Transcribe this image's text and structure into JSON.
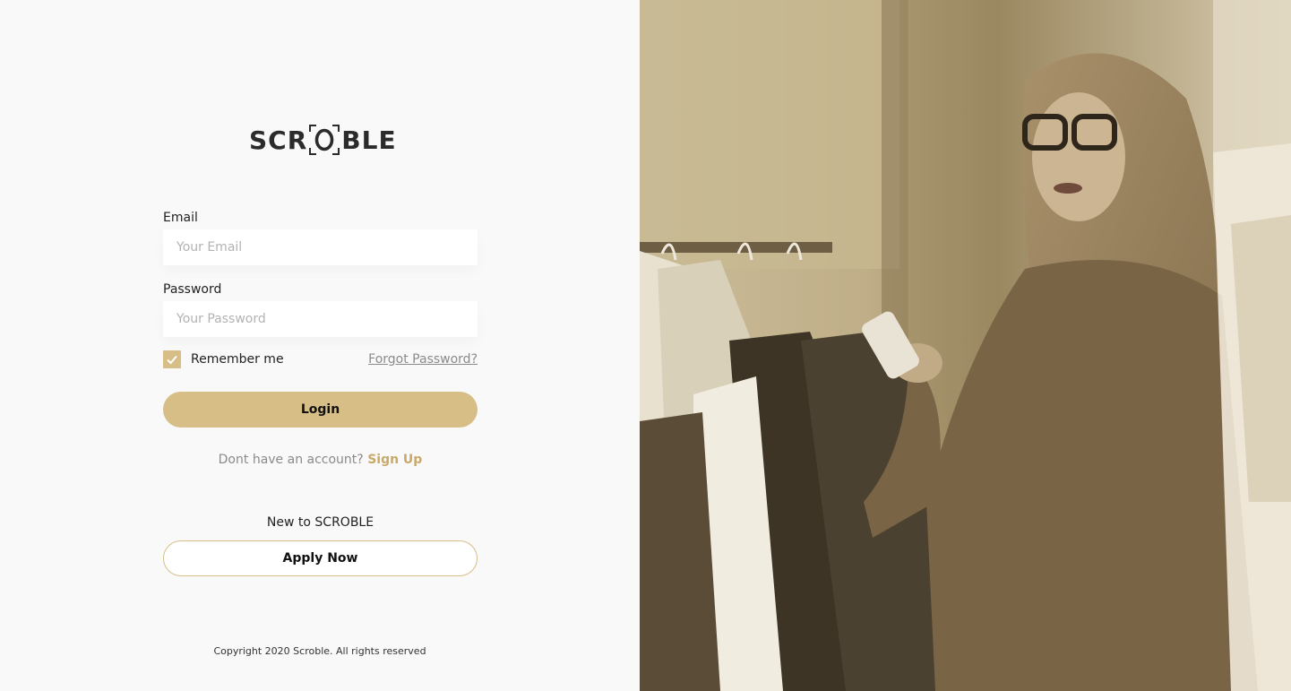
{
  "brand": {
    "logo_text_left": "SCR",
    "logo_text_right": "BLE",
    "accent_color": "#d7be87",
    "link_color": "#c9a96a"
  },
  "form": {
    "email_label": "Email",
    "email_placeholder": "Your Email",
    "email_value": "",
    "password_label": "Password",
    "password_placeholder": "Your Password",
    "password_value": "",
    "remember_label": "Remember me",
    "remember_checked": true,
    "forgot_label": "Forgot Password?",
    "login_label": "Login"
  },
  "signup": {
    "prompt": "Dont have an account?",
    "link_label": "Sign Up"
  },
  "apply": {
    "heading": "New to SCROBLE",
    "button_label": "Apply Now"
  },
  "footer": {
    "copyright": "Copyright 2020 Scroble. All rights reserved"
  },
  "icons": {
    "logo_o": "scanner-frame-o-icon",
    "checkbox": "check-icon"
  }
}
